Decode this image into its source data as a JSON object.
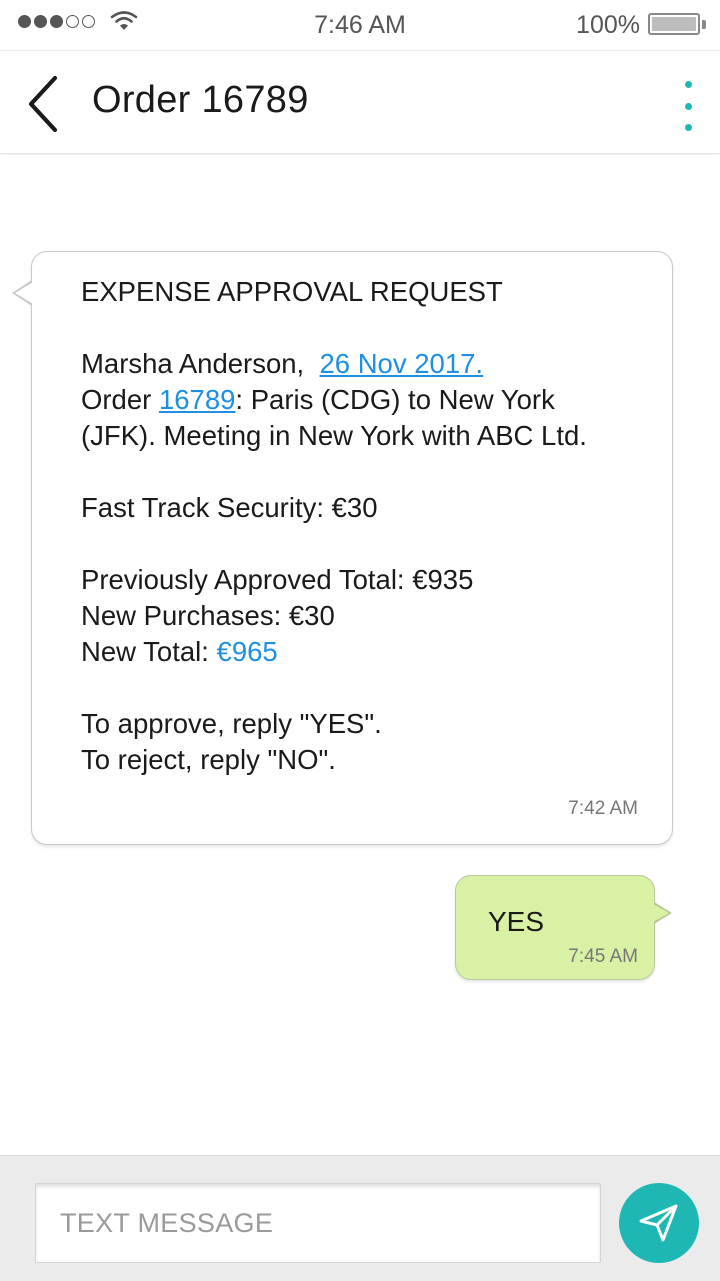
{
  "status_bar": {
    "time": "7:46 AM",
    "battery_percent": "100%",
    "signal_filled": 3,
    "signal_total": 5
  },
  "header": {
    "title": "Order 16789",
    "back_icon": "chevron-left-icon",
    "menu_icon": "more-vertical-icon"
  },
  "incoming_message": {
    "heading": "EXPENSE APPROVAL REQUEST",
    "name": "Marsha Anderson,",
    "date_link": "26 Nov 2017. ",
    "order_prefix": "Order ",
    "order_link": "16789",
    "order_rest": ": Paris (CDG) to New York",
    "meeting": "(JFK). Meeting in New York with ABC Ltd.",
    "fast_track": "Fast Track Security: €30",
    "previously_approved": "Previously Approved Total: €935",
    "new_purchases": "New Purchases: €30",
    "new_total_label": "New Total: ",
    "new_total_value": "€965",
    "approve_instruction": "To approve, reply \"YES\".",
    "reject_instruction": "To reject, reply \"NO\".",
    "timestamp": "7:42 AM"
  },
  "outgoing_message": {
    "text": "YES",
    "timestamp": "7:45 AM"
  },
  "composer": {
    "placeholder": "TEXT MESSAGE",
    "send_icon": "send-icon"
  },
  "colors": {
    "accent": "#1fb7b3",
    "link": "#1e8fe1",
    "outgoing_bubble": "#d8f1a4"
  }
}
